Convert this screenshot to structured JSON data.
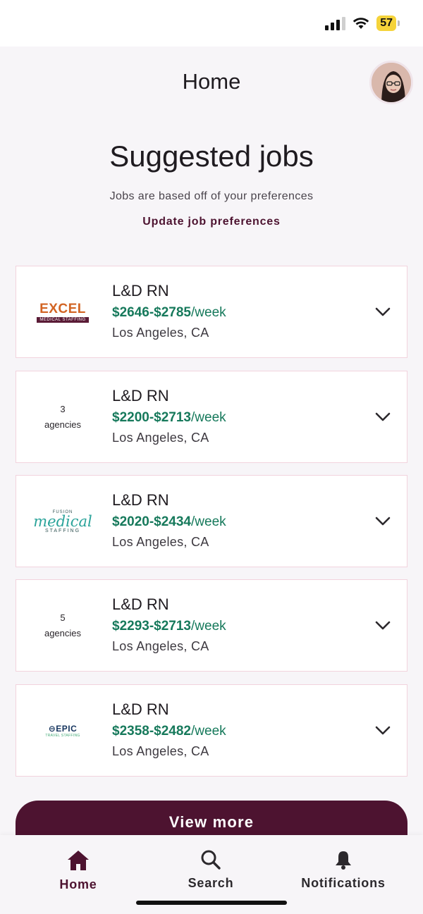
{
  "status_bar": {
    "battery": "57"
  },
  "header": {
    "title": "Home"
  },
  "suggested": {
    "title": "Suggested jobs",
    "subtitle": "Jobs are based off of your preferences",
    "update_link": "Update job preferences"
  },
  "jobs": [
    {
      "logo": "excel-logo",
      "logo_text": "EXCEL",
      "logo_sub": "MEDICAL STAFFING",
      "agencies_count": "",
      "agencies_label": "",
      "title": "L&D RN",
      "pay_range": "$2646-$2785",
      "pay_unit": "/week",
      "location": "Los Angeles, CA"
    },
    {
      "logo": "",
      "agencies_count": "3",
      "agencies_label": "agencies",
      "title": "L&D RN",
      "pay_range": "$2200-$2713",
      "pay_unit": "/week",
      "location": "Los Angeles, CA"
    },
    {
      "logo": "fusion-logo",
      "logo_text": "medical",
      "logo_small": "FUSION",
      "logo_sub": "STAFFING",
      "agencies_count": "",
      "agencies_label": "",
      "title": "L&D RN",
      "pay_range": "$2020-$2434",
      "pay_unit": "/week",
      "location": "Los Angeles, CA"
    },
    {
      "logo": "",
      "agencies_count": "5",
      "agencies_label": "agencies",
      "title": "L&D RN",
      "pay_range": "$2293-$2713",
      "pay_unit": "/week",
      "location": "Los Angeles, CA"
    },
    {
      "logo": "epic-logo",
      "logo_text": "EPIC",
      "logo_sub": "TRAVEL STAFFING",
      "agencies_count": "",
      "agencies_label": "",
      "title": "L&D RN",
      "pay_range": "$2358-$2482",
      "pay_unit": "/week",
      "location": "Los Angeles, CA"
    }
  ],
  "view_more": "View more",
  "nav": {
    "home": "Home",
    "search": "Search",
    "notifications": "Notifications"
  },
  "colors": {
    "brand": "#4d1330",
    "pay_green": "#16795b",
    "card_border": "#f2d3dd"
  }
}
